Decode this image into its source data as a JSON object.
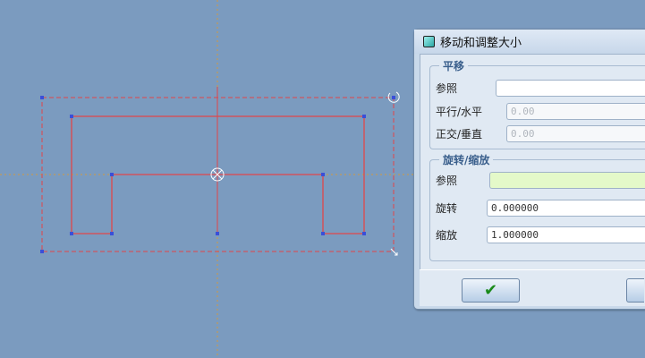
{
  "dialog": {
    "title": "移动和调整大小",
    "translate": {
      "legend": "平移",
      "ref_label": "参照",
      "ref_value": "",
      "horizontal_label": "平行/水平",
      "horizontal_value": "0.00",
      "vertical_label": "正交/垂直",
      "vertical_value": "0.00"
    },
    "rotate_scale": {
      "legend": "旋转/缩放",
      "ref_label": "参照",
      "ref_value": "",
      "rotate_label": "旋转",
      "rotate_value": "0.000000",
      "scale_label": "缩放",
      "scale_value": "1.000000"
    },
    "ok_icon": "check-icon"
  },
  "colors": {
    "background": "#7b9bbf",
    "sketch_line": "#e0464a",
    "vertex": "#3a4fd8",
    "axis": "#d09a40"
  }
}
